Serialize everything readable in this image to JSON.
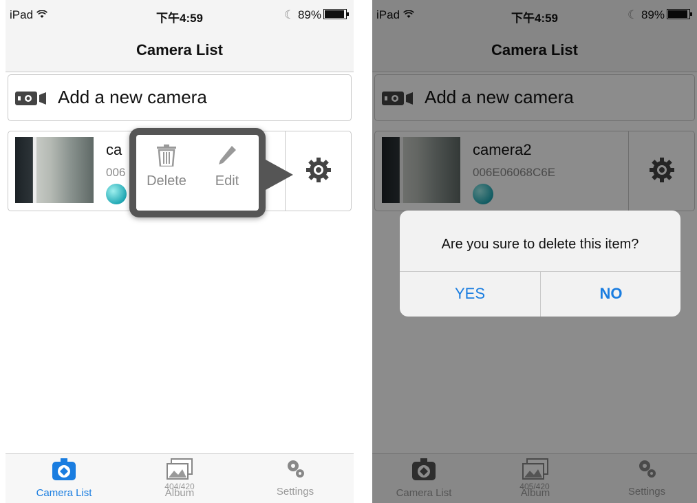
{
  "left": {
    "status": {
      "carrier": "iPad",
      "time": "下午4:59",
      "battery": "89%"
    },
    "nav_title": "Camera List",
    "add_camera_label": "Add a new camera",
    "camera": {
      "name_partial": "ca",
      "id_partial": "006"
    },
    "popover": {
      "delete_label": "Delete",
      "edit_label": "Edit"
    },
    "tabs": [
      {
        "label": "Camera List",
        "icon": "camera-icon",
        "active": true
      },
      {
        "label": "Album",
        "icon": "album-icon",
        "active": false
      },
      {
        "label": "Settings",
        "icon": "gear-icon",
        "active": false
      }
    ],
    "watermark": "404/420"
  },
  "right": {
    "status": {
      "carrier": "iPad",
      "time": "下午4:59",
      "battery": "89%"
    },
    "nav_title": "Camera List",
    "add_camera_label": "Add a new camera",
    "camera": {
      "name": "camera2",
      "id": "006E06068C6E"
    },
    "alert": {
      "message": "Are you sure to delete this item?",
      "yes": "YES",
      "no": "NO"
    },
    "tabs": [
      {
        "label": "Camera List",
        "icon": "camera-icon"
      },
      {
        "label": "Album",
        "icon": "album-icon"
      },
      {
        "label": "Settings",
        "icon": "gear-icon"
      }
    ],
    "watermark": "405/420"
  },
  "colors": {
    "accent": "#1a7de0",
    "status_dot": "#22a9b5",
    "popover_frame": "#555555"
  }
}
